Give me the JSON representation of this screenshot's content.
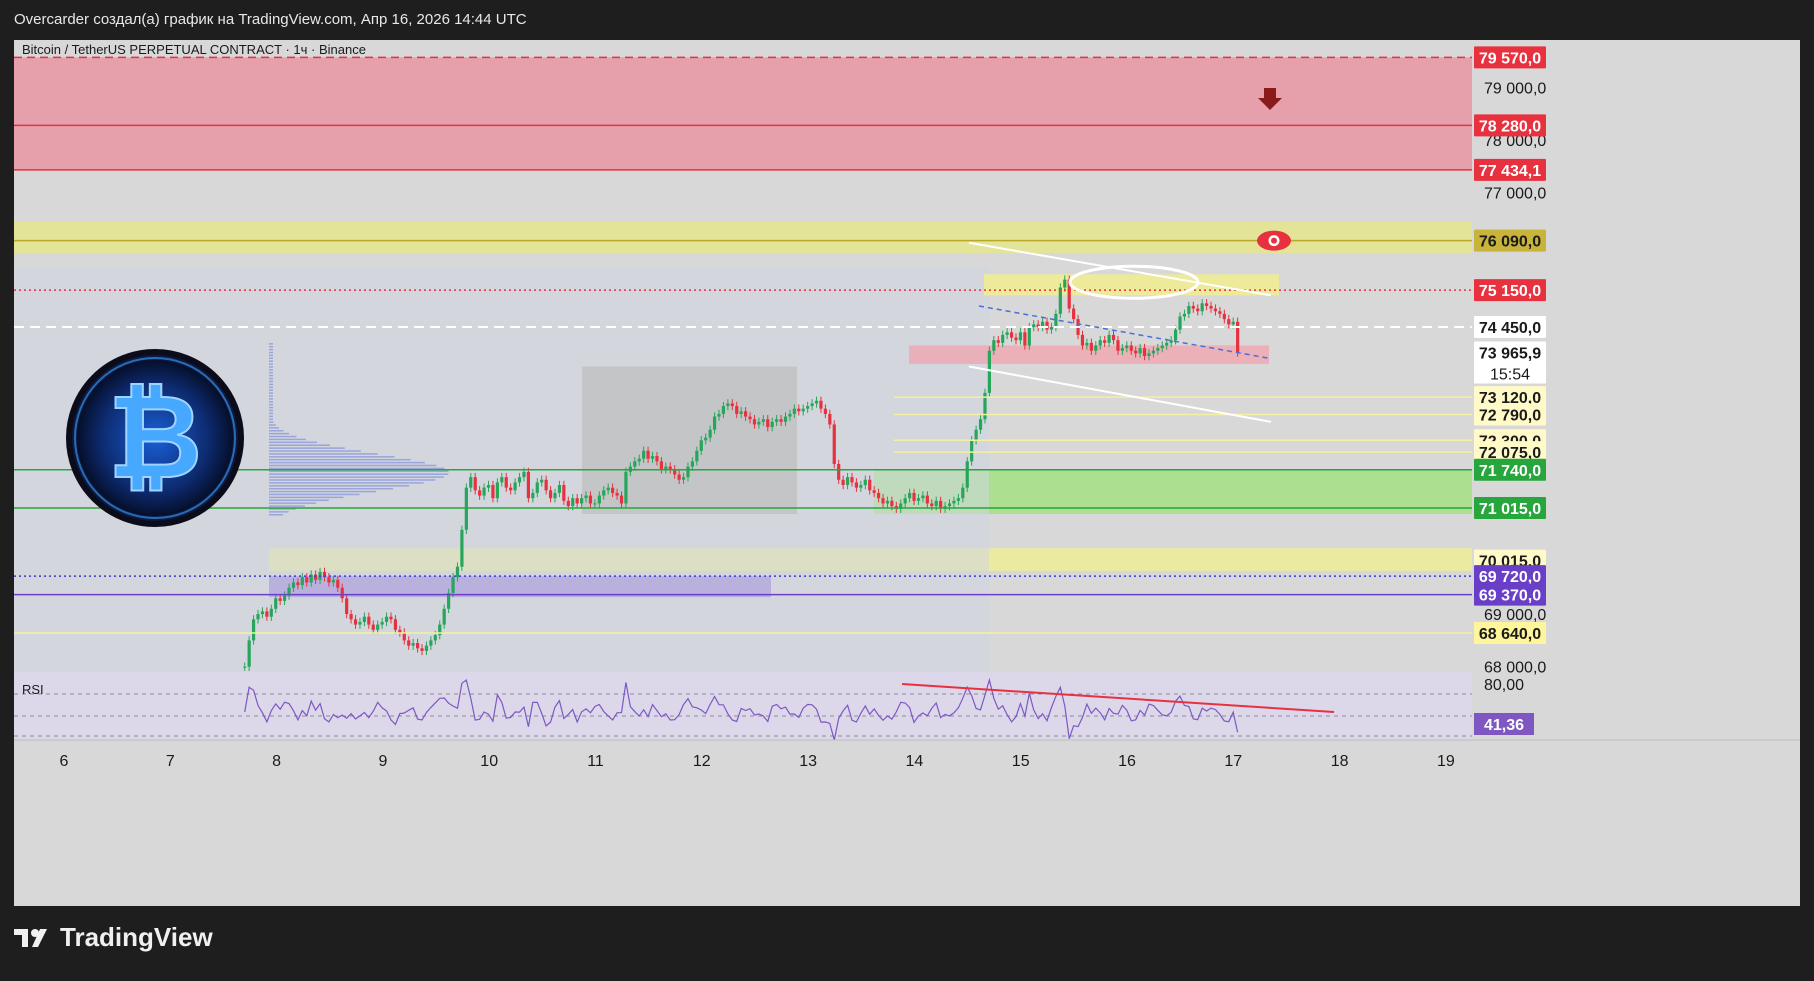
{
  "header": {
    "caption": "Overcarder создал(а) график на TradingView.com, Апр 16, 2026 14:44 UTC"
  },
  "chart_data": {
    "type": "candlestick",
    "symbol_title": "Bitcoin / TetherUS PERPETUAL CONTRACT · 1ч · Binance",
    "ylim": [
      67900,
      79900
    ],
    "x_ticks": [
      "6",
      "7",
      "8",
      "9",
      "10",
      "11",
      "12",
      "13",
      "14",
      "15",
      "16",
      "17",
      "18",
      "19"
    ],
    "y_ticks": [
      "79 000,0",
      "78 000,0",
      "77 000,0",
      "69 000,0",
      "68 000,0"
    ],
    "price_levels": [
      {
        "value": 79570.0,
        "label": "79 570,0",
        "bg": "#e8313f",
        "fg": "#ffffff",
        "line": "dashed-red"
      },
      {
        "value": 78280.0,
        "label": "78 280,0",
        "bg": "#e8313f",
        "fg": "#ffffff",
        "line": "red"
      },
      {
        "value": 77434.1,
        "label": "77 434,1",
        "bg": "#e8313f",
        "fg": "#ffffff",
        "line": "red"
      },
      {
        "value": 76090.0,
        "label": "76 090,0",
        "bg": "#c8b43a",
        "fg": "#1a1a1a",
        "line": "olive"
      },
      {
        "value": 75150.0,
        "label": "75 150,0",
        "bg": "#e8313f",
        "fg": "#ffffff",
        "line": "dotted-red"
      },
      {
        "value": 74450.0,
        "label": "74 450,0",
        "bg": "#ffffff",
        "fg": "#1a1a1a",
        "line": "dashed-white"
      },
      {
        "value": 73965.9,
        "label": "73 965,9",
        "bg": "#ffffff",
        "fg": "#1a1a1a",
        "line": "none"
      },
      {
        "value": 73120.0,
        "label": "73 120,0",
        "bg": "#fffac8",
        "fg": "#1a1a1a",
        "line": "yellow"
      },
      {
        "value": 72790.0,
        "label": "72 790,0",
        "bg": "#fffac8",
        "fg": "#1a1a1a",
        "line": "yellow"
      },
      {
        "value": 72300.0,
        "label": "72 300,0",
        "bg": "#fffac8",
        "fg": "#1a1a1a",
        "line": "yellow"
      },
      {
        "value": 72075.0,
        "label": "72 075,0",
        "bg": "#fffac8",
        "fg": "#1a1a1a",
        "line": "yellow"
      },
      {
        "value": 71740.0,
        "label": "71 740,0",
        "bg": "#26a63c",
        "fg": "#ffffff",
        "line": "green"
      },
      {
        "value": 71015.0,
        "label": "71 015,0",
        "bg": "#26a63c",
        "fg": "#ffffff",
        "line": "green"
      },
      {
        "value": 70015.0,
        "label": "70 015,0",
        "bg": "#fffac8",
        "fg": "#1a1a1a",
        "line": "none"
      },
      {
        "value": 69720.0,
        "label": "69 720,0",
        "bg": "#6a3fc8",
        "fg": "#ffffff",
        "line": "dotted-blue"
      },
      {
        "value": 69370.0,
        "label": "69 370,0",
        "bg": "#6a3fc8",
        "fg": "#ffffff",
        "line": "purple"
      },
      {
        "value": 68640.0,
        "label": "68 640,0",
        "bg": "#fff59a",
        "fg": "#1a1a1a",
        "line": "yellow"
      }
    ],
    "countdown": "15:54",
    "zones": [
      {
        "name": "supply",
        "from": 77434.1,
        "to": 79570.0,
        "color": "#e79aa6"
      },
      {
        "name": "resistance",
        "from": 75850,
        "to": 76450,
        "color": "#e6e692"
      },
      {
        "name": "demand",
        "from": 70900,
        "to": 71740,
        "color": "#a8e08a"
      },
      {
        "name": "support",
        "from": 69820,
        "to": 70250,
        "color": "#ecec9a"
      },
      {
        "name": "imbalance",
        "from": 69320,
        "to": 69720,
        "color": "#9b7ad8"
      }
    ],
    "candles": {
      "start_day": 6.0,
      "step_day": 0.0417,
      "close": [
        68000,
        68500,
        68900,
        69000,
        69050,
        68950,
        69100,
        69300,
        69250,
        69350,
        69500,
        69600,
        69550,
        69700,
        69600,
        69750,
        69650,
        69800,
        69700,
        69600,
        69650,
        69500,
        69300,
        69000,
        68900,
        68800,
        68850,
        68950,
        68800,
        68700,
        68800,
        68850,
        68950,
        68900,
        68700,
        68650,
        68500,
        68400,
        68450,
        68350,
        68300,
        68400,
        68500,
        68600,
        68800,
        69100,
        69400,
        69700,
        69900,
        70600,
        71400,
        71600,
        71350,
        71250,
        71400,
        71450,
        71200,
        71500,
        71600,
        71400,
        71350,
        71500,
        71600,
        71700,
        71200,
        71300,
        71500,
        71550,
        71350,
        71200,
        71300,
        71450,
        71150,
        71050,
        71200,
        71100,
        71200,
        71250,
        71100,
        71100,
        71250,
        71350,
        71400,
        71300,
        71250,
        71100,
        71700,
        71800,
        71900,
        71950,
        72100,
        71950,
        72000,
        71900,
        71750,
        71800,
        71750,
        71650,
        71550,
        71600,
        71800,
        71900,
        72100,
        72300,
        72350,
        72500,
        72750,
        72800,
        72950,
        73000,
        72950,
        72800,
        72850,
        72750,
        72700,
        72600,
        72650,
        72700,
        72550,
        72650,
        72700,
        72650,
        72750,
        72800,
        72900,
        72850,
        72900,
        72950,
        73000,
        73050,
        72900,
        72800,
        72600,
        71850,
        71550,
        71450,
        71600,
        71500,
        71400,
        71450,
        71550,
        71350,
        71300,
        71200,
        71100,
        71150,
        71050,
        71000,
        71100,
        71200,
        71300,
        71150,
        71200,
        71250,
        71100,
        71050,
        71150,
        71000,
        71050,
        71100,
        71150,
        71200,
        71400,
        71900,
        72300,
        72500,
        72700,
        73200,
        74000,
        74200,
        74150,
        74300,
        74350,
        74250,
        74200,
        74350,
        74100,
        74450,
        74500,
        74450,
        74550,
        74400,
        74450,
        74700,
        75200,
        75350,
        74800,
        74600,
        74300,
        74100,
        74150,
        74000,
        74100,
        74200,
        74150,
        74300,
        74200,
        74000,
        74050,
        74100,
        74000,
        73950,
        74050,
        73900,
        73950,
        74000,
        74050,
        74100,
        74150,
        74200,
        74400,
        74650,
        74700,
        74850,
        74800,
        74750,
        74900,
        74850,
        74800,
        74750,
        74700,
        74600,
        74500,
        74550,
        73966
      ]
    },
    "rsi": {
      "label": "RSI",
      "level_label": "80,00",
      "value_label": "41,36",
      "value_color": "#7e57c2"
    }
  }
}
